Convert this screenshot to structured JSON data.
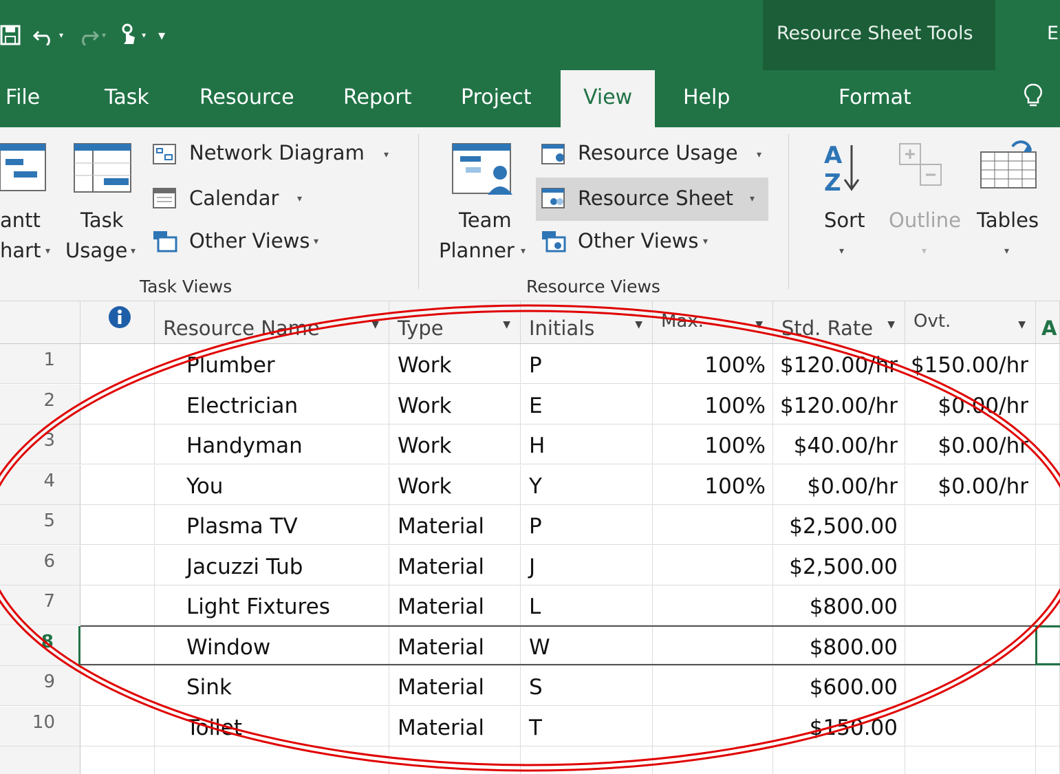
{
  "qat": {
    "save_icon": "save-icon",
    "undo_icon": "undo-icon",
    "redo_icon": "redo-icon",
    "touch_icon": "touch-mode-icon",
    "customize_icon": "customize-qat-icon"
  },
  "context_tab_title": "Resource Sheet Tools",
  "title_edge": "E",
  "tabs": {
    "file": "File",
    "task": "Task",
    "resource": "Resource",
    "report": "Report",
    "project": "Project",
    "view": "View",
    "help": "Help",
    "format": "Format"
  },
  "ribbon": {
    "gantt_line1": "antt",
    "gantt_line2": "hart",
    "task_usage_line1": "Task",
    "task_usage_line2": "Usage",
    "network_diagram": "Network Diagram",
    "calendar": "Calendar",
    "task_other_views": "Other Views",
    "task_views_label": "Task Views",
    "team_planner_line1": "Team",
    "team_planner_line2": "Planner",
    "resource_usage": "Resource Usage",
    "resource_sheet": "Resource Sheet",
    "resource_other_views": "Other Views",
    "resource_views_label": "Resource Views",
    "sort": "Sort",
    "outline": "Outline",
    "tables": "Tables"
  },
  "grid": {
    "columns": {
      "name": "Resource Name",
      "type": "Type",
      "initials": "Initials",
      "max": "Max.",
      "std_rate": "Std. Rate",
      "ovt": "Ovt.",
      "edge": "A"
    },
    "rows": [
      {
        "id": "1",
        "name": "Plumber",
        "type": "Work",
        "initials": "P",
        "max": "100%",
        "std_rate": "$120.00/hr",
        "ovt": "$150.00/hr"
      },
      {
        "id": "2",
        "name": "Electrician",
        "type": "Work",
        "initials": "E",
        "max": "100%",
        "std_rate": "$120.00/hr",
        "ovt": "$0.00/hr"
      },
      {
        "id": "3",
        "name": "Handyman",
        "type": "Work",
        "initials": "H",
        "max": "100%",
        "std_rate": "$40.00/hr",
        "ovt": "$0.00/hr"
      },
      {
        "id": "4",
        "name": "You",
        "type": "Work",
        "initials": "Y",
        "max": "100%",
        "std_rate": "$0.00/hr",
        "ovt": "$0.00/hr"
      },
      {
        "id": "5",
        "name": "Plasma TV",
        "type": "Material",
        "initials": "P",
        "max": "",
        "std_rate": "$2,500.00",
        "ovt": ""
      },
      {
        "id": "6",
        "name": "Jacuzzi Tub",
        "type": "Material",
        "initials": "J",
        "max": "",
        "std_rate": "$2,500.00",
        "ovt": ""
      },
      {
        "id": "7",
        "name": "Light Fixtures",
        "type": "Material",
        "initials": "L",
        "max": "",
        "std_rate": "$800.00",
        "ovt": ""
      },
      {
        "id": "8",
        "name": "Window",
        "type": "Material",
        "initials": "W",
        "max": "",
        "std_rate": "$800.00",
        "ovt": ""
      },
      {
        "id": "9",
        "name": "Sink",
        "type": "Material",
        "initials": "S",
        "max": "",
        "std_rate": "$600.00",
        "ovt": ""
      },
      {
        "id": "10",
        "name": "Toilet",
        "type": "Material",
        "initials": "T",
        "max": "",
        "std_rate": "$150.00",
        "ovt": ""
      }
    ],
    "selected_row": "8"
  },
  "colors": {
    "brand_green": "#217346",
    "context_green": "#1b5e37",
    "annotation_red": "#e00000"
  }
}
